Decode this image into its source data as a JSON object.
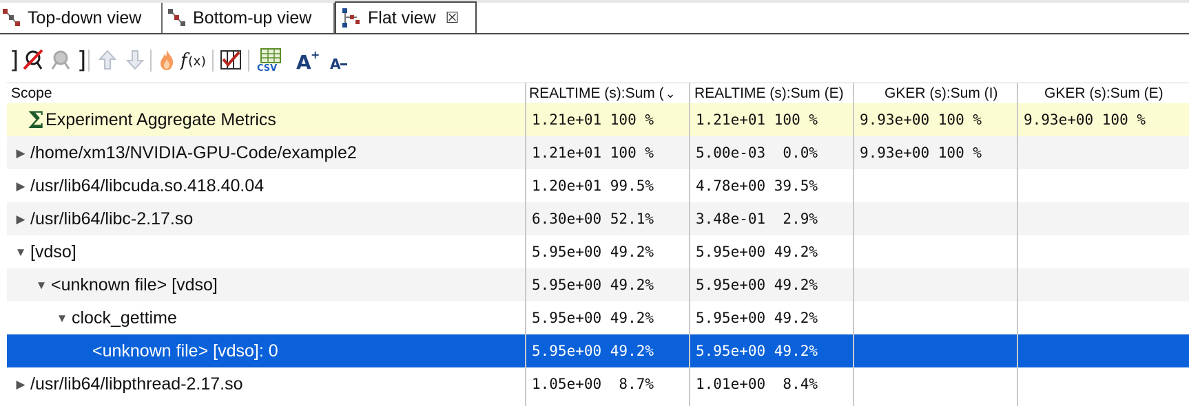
{
  "tabs": [
    {
      "label": "Top-down view",
      "active": false
    },
    {
      "label": "Bottom-up view",
      "active": false
    },
    {
      "label": "Flat view",
      "active": true
    }
  ],
  "toolbar": {
    "icons": [
      "flatten-icon",
      "unflatten-icon",
      "zoom-in-icon",
      "zoom-out-icon",
      "hot-path-icon",
      "derived-metric-icon",
      "column-toggle-icon",
      "export-csv-icon",
      "font-larger-icon",
      "font-smaller-icon"
    ],
    "csv_label": "CSV",
    "font_larger_label": "A",
    "font_smaller_label": "A"
  },
  "table": {
    "columns": [
      "Scope",
      "REALTIME (s):Sum (",
      "REALTIME (s):Sum (E)",
      "GKER (s):Sum (I)",
      "GKER (s):Sum (E)"
    ],
    "rows": [
      {
        "scope": "Experiment Aggregate Metrics",
        "indent": 0,
        "expand": "sigma",
        "c1": "1.21e+01 100 %",
        "c2": "1.21e+01 100 %",
        "c3": "9.93e+00 100 %",
        "c4": "9.93e+00 100 %"
      },
      {
        "scope": "/home/xm13/NVIDIA-GPU-Code/example2",
        "indent": 0,
        "expand": "collapsed",
        "c1": "1.21e+01 100 %",
        "c2": "5.00e-03  0.0%",
        "c3": "9.93e+00 100 %",
        "c4": ""
      },
      {
        "scope": "/usr/lib64/libcuda.so.418.40.04",
        "indent": 0,
        "expand": "collapsed",
        "c1": "1.20e+01 99.5%",
        "c2": "4.78e+00 39.5%",
        "c3": "",
        "c4": ""
      },
      {
        "scope": "/usr/lib64/libc-2.17.so",
        "indent": 0,
        "expand": "collapsed",
        "c1": "6.30e+00 52.1%",
        "c2": "3.48e-01  2.9%",
        "c3": "",
        "c4": ""
      },
      {
        "scope": "[vdso]",
        "indent": 0,
        "expand": "expanded",
        "c1": "5.95e+00 49.2%",
        "c2": "5.95e+00 49.2%",
        "c3": "",
        "c4": ""
      },
      {
        "scope": "<unknown file> [vdso]",
        "indent": 1,
        "expand": "expanded",
        "c1": "5.95e+00 49.2%",
        "c2": "5.95e+00 49.2%",
        "c3": "",
        "c4": ""
      },
      {
        "scope": "clock_gettime",
        "indent": 2,
        "expand": "expanded",
        "c1": "5.95e+00 49.2%",
        "c2": "5.95e+00 49.2%",
        "c3": "",
        "c4": ""
      },
      {
        "scope": "<unknown file> [vdso]: 0",
        "indent": 3,
        "expand": "none",
        "selected": true,
        "c1": "5.95e+00 49.2%",
        "c2": "5.95e+00 49.2%",
        "c3": "",
        "c4": ""
      },
      {
        "scope": "/usr/lib64/libpthread-2.17.so",
        "indent": 0,
        "expand": "collapsed",
        "c1": "1.05e+00  8.7%",
        "c2": "1.01e+00  8.4%",
        "c3": "",
        "c4": ""
      }
    ]
  },
  "colors": {
    "selection": "#0a61d9",
    "aggregate_row": "#fcfcd2",
    "alt_row": "#f4f4f4",
    "sigma": "#1f5a2a"
  }
}
